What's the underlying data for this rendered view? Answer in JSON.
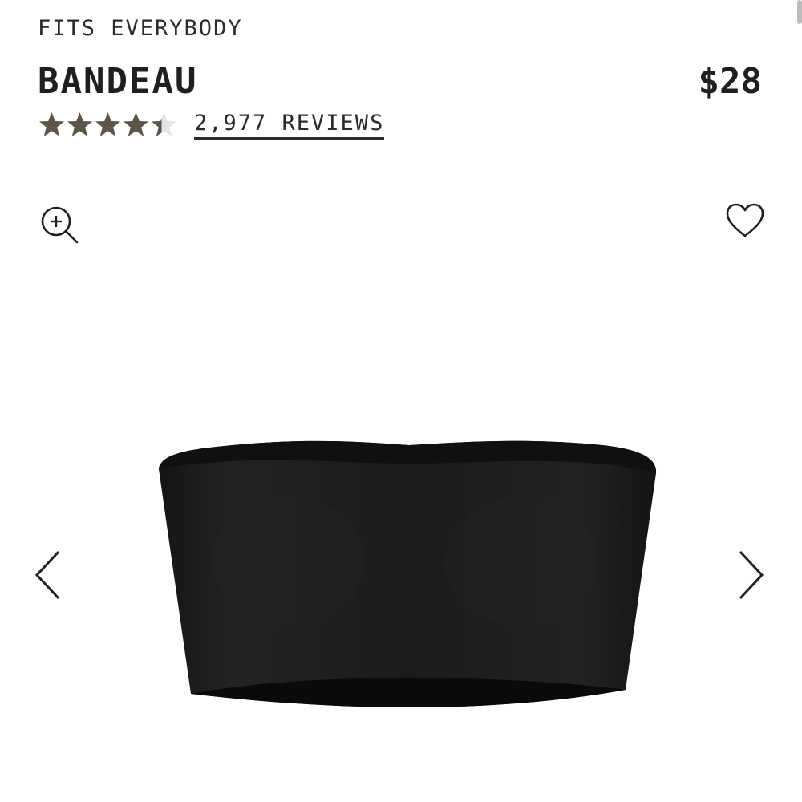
{
  "product": {
    "collection": "FITS EVERYBODY",
    "title": "BANDEAU",
    "price": "$28",
    "rating": 4.4,
    "rating_max": 5,
    "reviews_label": "2,977 REVIEWS",
    "image_color": "black"
  },
  "colors": {
    "star_filled": "#5e5549",
    "star_empty": "#e4e4e4",
    "text": "#1f1f1f"
  },
  "icons": {
    "zoom": "zoom-in-icon",
    "wishlist": "heart-icon",
    "prev": "chevron-left-icon",
    "next": "chevron-right-icon"
  }
}
